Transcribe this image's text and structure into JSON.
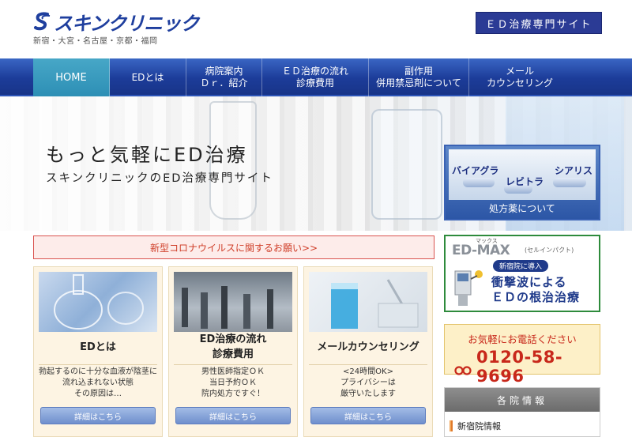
{
  "header": {
    "logo_text": "スキンクリニック",
    "locations": "新宿・大宮・名古屋・京都・福岡",
    "site_button": "ＥＤ治療専門サイト"
  },
  "nav": {
    "items": [
      {
        "label": "HOME",
        "active": true
      },
      {
        "label": "EDとは",
        "active": false
      },
      {
        "label": "病院案内\nＤｒ．紹介",
        "active": false
      },
      {
        "label": "ＥＤ治療の流れ\n診療費用",
        "active": false
      },
      {
        "label": "副作用\n併用禁忌剤について",
        "active": false
      },
      {
        "label": "メール\nカウンセリング",
        "active": false
      }
    ]
  },
  "hero": {
    "title": "もっと気軽にED治療",
    "subtitle": "スキンクリニックのED治療専門サイト"
  },
  "drug_banner": {
    "names": [
      "バイアグラ",
      "レビトラ",
      "シアリス"
    ],
    "label": "処方薬について"
  },
  "notice": {
    "text": "新型コロナウイルスに関するお願い>>"
  },
  "cards": [
    {
      "title": "EDとは",
      "description": "勃起するのに十分な血液が陰茎に\n流れ込まれない状態\nその原因は…",
      "button": "詳細はこちら"
    },
    {
      "title": "ED治療の流れ\n診療費用",
      "description": "男性医師指定ＯＫ\n当日予約ＯＫ\n院内処方ですぐ！",
      "button": "詳細はこちら"
    },
    {
      "title": "メールカウンセリング",
      "description": "<24時間OK>\nプライバシーは\n厳守いたします",
      "button": "詳細はこちら"
    }
  ],
  "edmax": {
    "kana": "マックス",
    "title": "ED-MAX",
    "subtitle": "(セルインパクト)",
    "badge": "新宿院に導入",
    "text": "衝撃波による\nＥＤの根治治療"
  },
  "phone": {
    "caption": "お気軽にお電話ください",
    "number": "0120-58-9696"
  },
  "clinic_info": {
    "heading": "各院情報",
    "items": [
      "新宿院情報"
    ]
  },
  "colors": {
    "brand_blue": "#1f3f9e",
    "nav_blue": "#1c3c99",
    "nav_active": "#2d8fb5",
    "notice_red": "#d0402b",
    "phone_red": "#c8281b",
    "card_bg": "#fdf4e3"
  }
}
